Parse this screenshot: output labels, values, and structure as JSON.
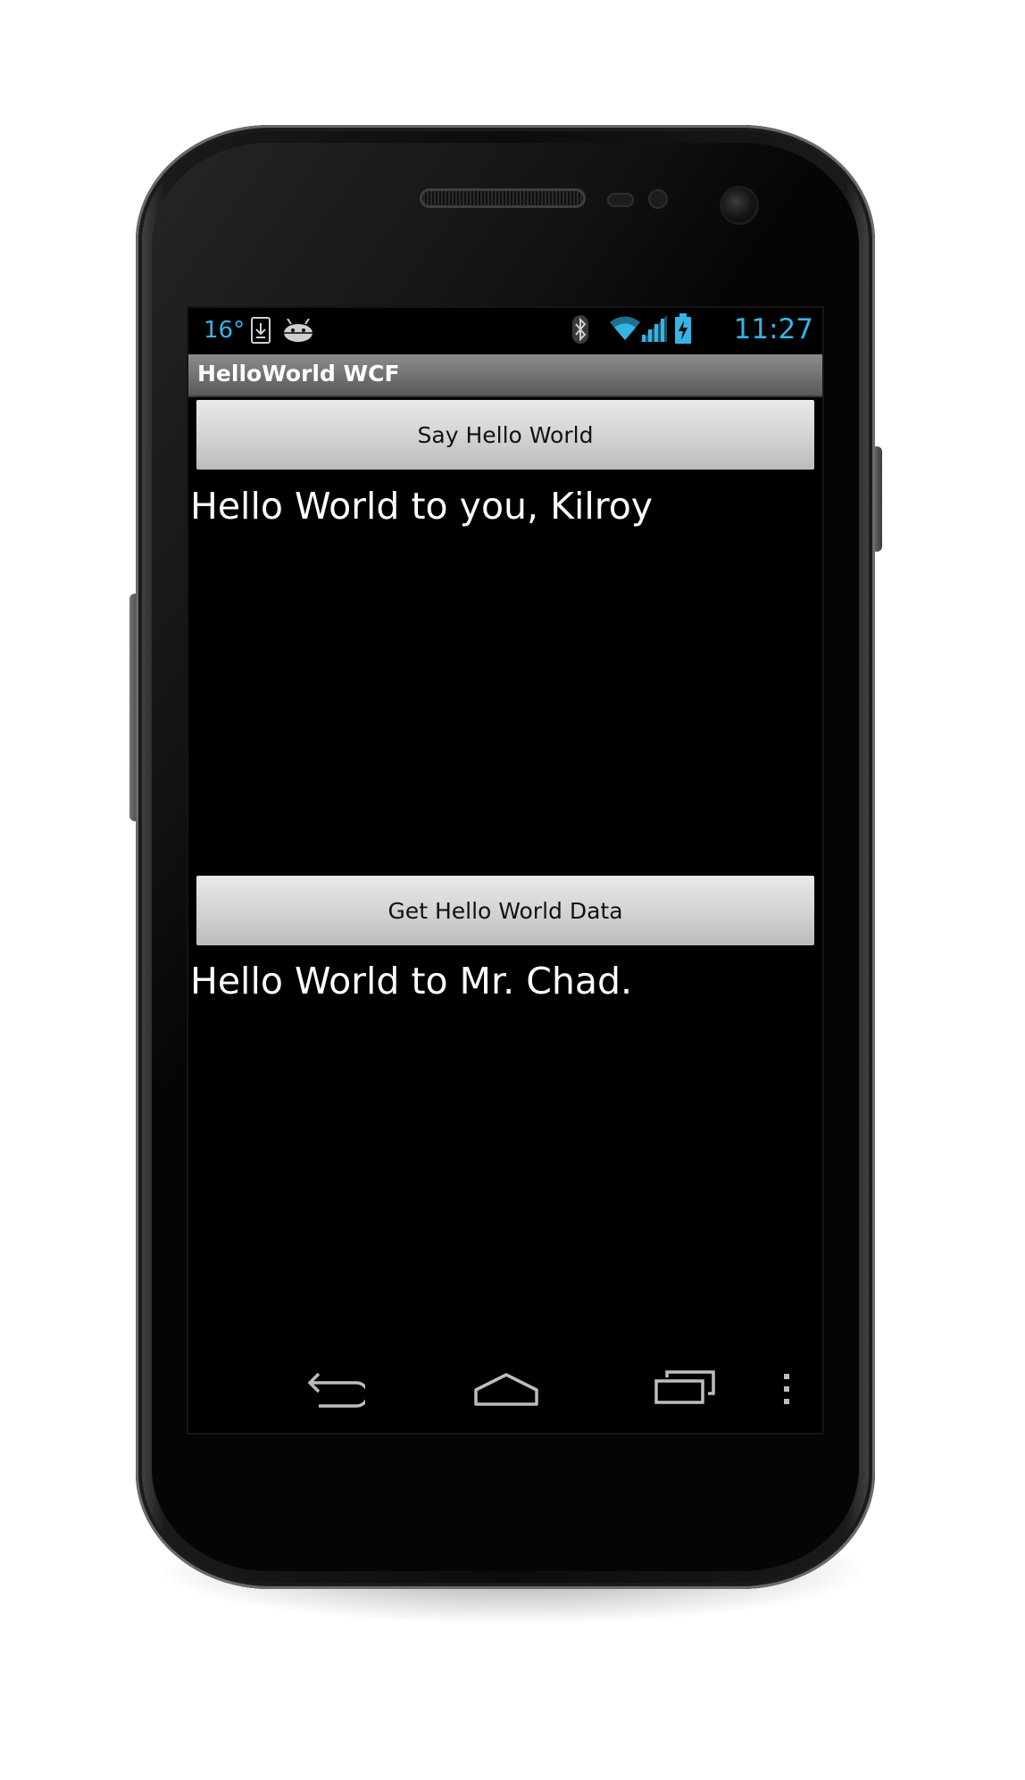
{
  "status_bar": {
    "temperature": "16°",
    "time": "11:27",
    "accent_color": "#33b5e5",
    "left_icons": [
      "download-icon",
      "android-debug-icon"
    ],
    "right_icons": [
      "bluetooth-icon",
      "wifi-icon",
      "signal-icon",
      "battery-charging-icon"
    ]
  },
  "app": {
    "title": "HelloWorld WCF",
    "say_hello_button": "Say Hello World",
    "say_hello_result": "Hello World to you, Kilroy",
    "get_data_button": "Get Hello World Data",
    "get_data_result": "Hello World to Mr. Chad."
  },
  "navigation": {
    "buttons": [
      "back-icon",
      "home-icon",
      "recent-apps-icon",
      "menu-icon"
    ]
  }
}
